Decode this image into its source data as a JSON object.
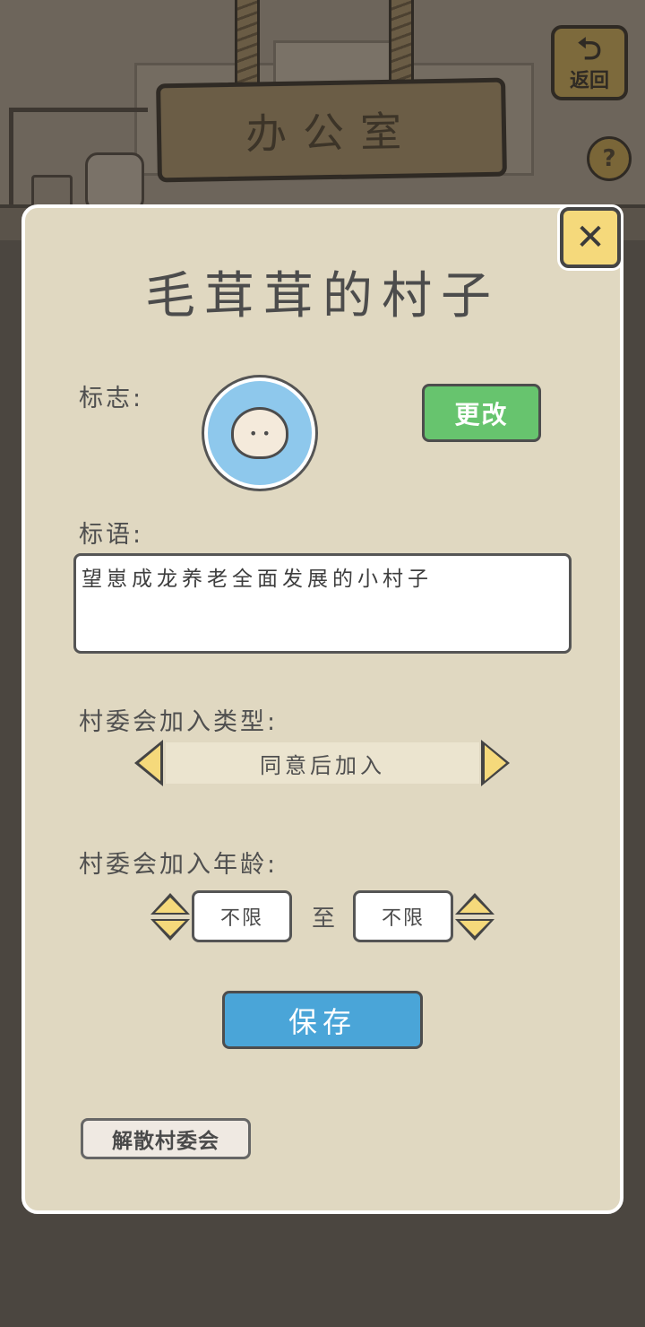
{
  "header": {
    "sign_title": "办公室",
    "back_label": "返回",
    "help_symbol": "?"
  },
  "dialog": {
    "close_symbol": "✕",
    "title": "毛茸茸的村子",
    "emblem_label": "标志:",
    "change_button": "更改",
    "motto_label": "标语:",
    "motto_value": "望崽成龙养老全面发展的小村子",
    "join_type_label": "村委会加入类型:",
    "join_type_value": "同意后加入",
    "join_age_label": "村委会加入年龄:",
    "age_min": "不限",
    "age_to": "至",
    "age_max": "不限",
    "save_button": "保存",
    "disband_button": "解散村委会"
  },
  "colors": {
    "dialog_bg": "#e0d8c1",
    "change_button": "#67c46e",
    "save_button": "#4aa5d8",
    "close_button": "#f5d97b",
    "emblem_bg": "#8ec8ec"
  },
  "icons": [
    "back-arrow-icon",
    "help-icon",
    "close-icon",
    "sheep-emblem-icon",
    "arrow-left-icon",
    "arrow-right-icon",
    "stepper-icon"
  ]
}
